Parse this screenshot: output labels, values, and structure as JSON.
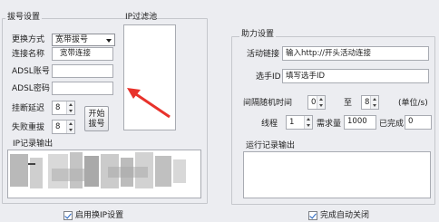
{
  "left_panel": {
    "group_title": "拔号设置",
    "change_method_label": "更换方式",
    "change_method_value": "宽带拔号",
    "conn_name_label": "连接名称",
    "conn_name_value": "宽带连接",
    "adsl_account_label": "ADSL账号",
    "adsl_account_value": "",
    "adsl_password_label": "ADSL密码",
    "adsl_password_value": "",
    "hangup_delay_label": "挂断延迟",
    "hangup_delay_value": "8",
    "fail_retry_label": "失败重拔",
    "fail_retry_value": "8",
    "start_button_line1": "开始",
    "start_button_line2": "拔号",
    "ip_filter_title": "IP过滤池",
    "ip_log_title": "IP记录输出",
    "enable_ip_label": "启用换IP设置",
    "enable_ip_checked": true
  },
  "right_panel": {
    "group_title": "助力设置",
    "activity_link_label": "活动链接",
    "activity_link_value": "输入http://开头活动连接",
    "player_id_label": "选手ID",
    "player_id_value": "填写选手ID",
    "interval_label": "间隔随机时间",
    "interval_min": "0",
    "to_label": "至",
    "interval_max": "8",
    "unit_label": "(单位/s)",
    "threads_label": "线程",
    "threads_value": "1",
    "demand_label": "需求量",
    "demand_value": "1000",
    "done_label": "已完成",
    "done_value": "0",
    "run_log_title": "运行记录输出",
    "auto_close_label": "完成自动关闭",
    "auto_close_checked": true
  },
  "annotation": {
    "arrow_color": "#e8322b"
  }
}
